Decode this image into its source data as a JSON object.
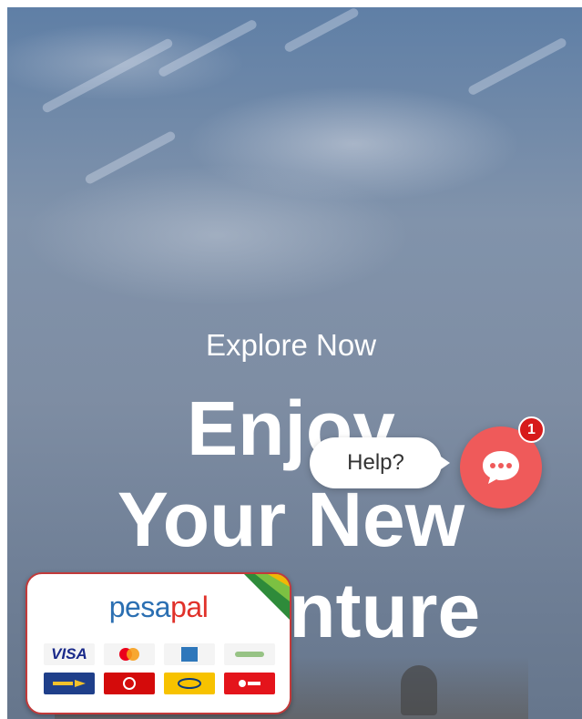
{
  "hero": {
    "kicker": "Explore Now",
    "headline_lines": [
      "Enjoy",
      "Your New",
      "Adventure"
    ]
  },
  "help_widget": {
    "bubble_text": "Help?",
    "badge_count": "1",
    "icon": "chat-icon",
    "button_color": "#ef5a5a",
    "badge_color": "#d71a1a"
  },
  "payment_card": {
    "logo_part1": "pesa",
    "logo_part2": "pal",
    "methods_row1": [
      "VISA",
      "mastercard",
      "amex",
      "mpesa"
    ],
    "methods_row2": [
      "equitel",
      "vodafone",
      "mtn",
      "airtel"
    ],
    "border_color": "#c23a3a"
  }
}
